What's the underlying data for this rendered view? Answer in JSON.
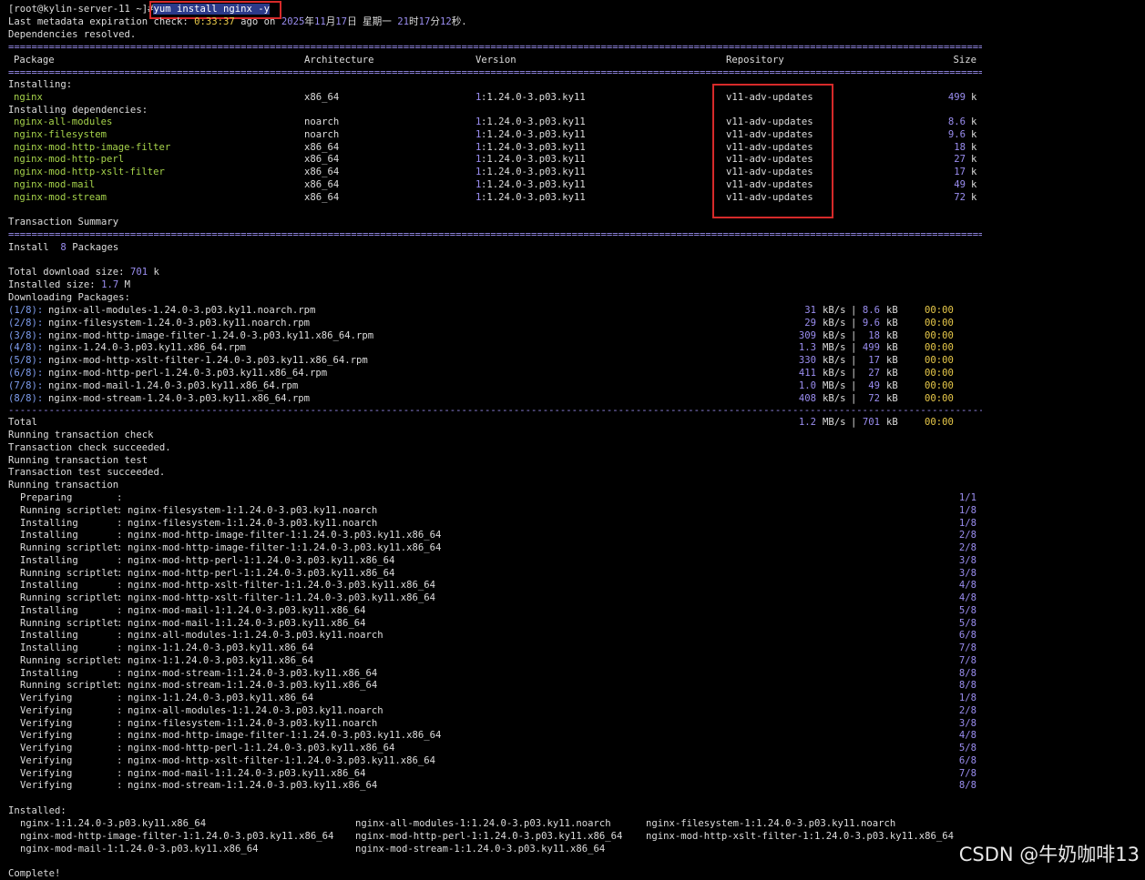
{
  "terminal": {
    "prompt": "[root@kylin-server-11 ~]#",
    "command": "yum install nginx -y",
    "meta_line": {
      "prefix": "Last metadata expiration check:",
      "elapsed": "0:33:37",
      "mid": "ago on",
      "year": "2025",
      "y_unit": "年",
      "month": "11",
      "m_unit": "月",
      "day": "17",
      "d_unit": "日 星期一",
      "hour": "21",
      "h_unit": "时",
      "minute": "17",
      "mi_unit": "分",
      "second": "12",
      "s_unit": "秒."
    },
    "deps_resolved": "Dependencies resolved.",
    "table_headers": {
      "package": "Package",
      "arch": "Architecture",
      "version": "Version",
      "repo": "Repository",
      "size": "Size"
    },
    "installing_label": "Installing:",
    "installing": [
      {
        "name": "nginx",
        "arch": "x86_64",
        "epoch": "1",
        "version": ":1.24.0-3.p03.ky11",
        "repo": "v11-adv-updates",
        "size": "499",
        "unit": "k"
      }
    ],
    "deps_label": "Installing dependencies:",
    "dependencies": [
      {
        "name": "nginx-all-modules",
        "arch": "noarch",
        "epoch": "1",
        "version": ":1.24.0-3.p03.ky11",
        "repo": "v11-adv-updates",
        "size": "8.6",
        "unit": "k"
      },
      {
        "name": "nginx-filesystem",
        "arch": "noarch",
        "epoch": "1",
        "version": ":1.24.0-3.p03.ky11",
        "repo": "v11-adv-updates",
        "size": "9.6",
        "unit": "k"
      },
      {
        "name": "nginx-mod-http-image-filter",
        "arch": "x86_64",
        "epoch": "1",
        "version": ":1.24.0-3.p03.ky11",
        "repo": "v11-adv-updates",
        "size": "18",
        "unit": "k"
      },
      {
        "name": "nginx-mod-http-perl",
        "arch": "x86_64",
        "epoch": "1",
        "version": ":1.24.0-3.p03.ky11",
        "repo": "v11-adv-updates",
        "size": "27",
        "unit": "k"
      },
      {
        "name": "nginx-mod-http-xslt-filter",
        "arch": "x86_64",
        "epoch": "1",
        "version": ":1.24.0-3.p03.ky11",
        "repo": "v11-adv-updates",
        "size": "17",
        "unit": "k"
      },
      {
        "name": "nginx-mod-mail",
        "arch": "x86_64",
        "epoch": "1",
        "version": ":1.24.0-3.p03.ky11",
        "repo": "v11-adv-updates",
        "size": "49",
        "unit": "k"
      },
      {
        "name": "nginx-mod-stream",
        "arch": "x86_64",
        "epoch": "1",
        "version": ":1.24.0-3.p03.ky11",
        "repo": "v11-adv-updates",
        "size": "72",
        "unit": "k"
      }
    ],
    "transaction_summary": "Transaction Summary",
    "install_count": {
      "label": "Install",
      "count": "8",
      "suffix": "Packages"
    },
    "total_download": {
      "label": "Total download size:",
      "value": "701",
      "unit": "k"
    },
    "installed_size": {
      "label": "Installed size:",
      "value": "1.7",
      "unit": "M"
    },
    "downloading_label": "Downloading Packages:",
    "downloads": [
      {
        "idx": "(1/8):",
        "file": "nginx-all-modules-1.24.0-3.p03.ky11.noarch.rpm",
        "speed": "31",
        "speed_unit": "kB/s",
        "size": "8.6",
        "size_unit": "kB",
        "time": "00:00"
      },
      {
        "idx": "(2/8):",
        "file": "nginx-filesystem-1.24.0-3.p03.ky11.noarch.rpm",
        "speed": "29",
        "speed_unit": "kB/s",
        "size": "9.6",
        "size_unit": "kB",
        "time": "00:00"
      },
      {
        "idx": "(3/8):",
        "file": "nginx-mod-http-image-filter-1.24.0-3.p03.ky11.x86_64.rpm",
        "speed": "309",
        "speed_unit": "kB/s",
        "size": "18",
        "size_unit": "kB",
        "time": "00:00"
      },
      {
        "idx": "(4/8):",
        "file": "nginx-1.24.0-3.p03.ky11.x86_64.rpm",
        "speed": "1.3",
        "speed_unit": "MB/s",
        "size": "499",
        "size_unit": "kB",
        "time": "00:00"
      },
      {
        "idx": "(5/8):",
        "file": "nginx-mod-http-xslt-filter-1.24.0-3.p03.ky11.x86_64.rpm",
        "speed": "330",
        "speed_unit": "kB/s",
        "size": "17",
        "size_unit": "kB",
        "time": "00:00"
      },
      {
        "idx": "(6/8):",
        "file": "nginx-mod-http-perl-1.24.0-3.p03.ky11.x86_64.rpm",
        "speed": "411",
        "speed_unit": "kB/s",
        "size": "27",
        "size_unit": "kB",
        "time": "00:00"
      },
      {
        "idx": "(7/8):",
        "file": "nginx-mod-mail-1.24.0-3.p03.ky11.x86_64.rpm",
        "speed": "1.0",
        "speed_unit": "MB/s",
        "size": "49",
        "size_unit": "kB",
        "time": "00:00"
      },
      {
        "idx": "(8/8):",
        "file": "nginx-mod-stream-1.24.0-3.p03.ky11.x86_64.rpm",
        "speed": "408",
        "speed_unit": "kB/s",
        "size": "72",
        "size_unit": "kB",
        "time": "00:00"
      }
    ],
    "total": {
      "label": "Total",
      "speed": "1.2",
      "speed_unit": "MB/s",
      "size": "701",
      "size_unit": "kB",
      "time": "00:00"
    },
    "status_lines": [
      "Running transaction check",
      "Transaction check succeeded.",
      "Running transaction test",
      "Transaction test succeeded.",
      "Running transaction"
    ],
    "steps": [
      {
        "action": "Preparing",
        "pkg": "",
        "n": "1/1"
      },
      {
        "action": "Running scriptlet",
        "pkg": "nginx-filesystem-1:1.24.0-3.p03.ky11.noarch",
        "n": "1/8"
      },
      {
        "action": "Installing",
        "pkg": "nginx-filesystem-1:1.24.0-3.p03.ky11.noarch",
        "n": "1/8"
      },
      {
        "action": "Installing",
        "pkg": "nginx-mod-http-image-filter-1:1.24.0-3.p03.ky11.x86_64",
        "n": "2/8"
      },
      {
        "action": "Running scriptlet",
        "pkg": "nginx-mod-http-image-filter-1:1.24.0-3.p03.ky11.x86_64",
        "n": "2/8"
      },
      {
        "action": "Installing",
        "pkg": "nginx-mod-http-perl-1:1.24.0-3.p03.ky11.x86_64",
        "n": "3/8"
      },
      {
        "action": "Running scriptlet",
        "pkg": "nginx-mod-http-perl-1:1.24.0-3.p03.ky11.x86_64",
        "n": "3/8"
      },
      {
        "action": "Installing",
        "pkg": "nginx-mod-http-xslt-filter-1:1.24.0-3.p03.ky11.x86_64",
        "n": "4/8"
      },
      {
        "action": "Running scriptlet",
        "pkg": "nginx-mod-http-xslt-filter-1:1.24.0-3.p03.ky11.x86_64",
        "n": "4/8"
      },
      {
        "action": "Installing",
        "pkg": "nginx-mod-mail-1:1.24.0-3.p03.ky11.x86_64",
        "n": "5/8"
      },
      {
        "action": "Running scriptlet",
        "pkg": "nginx-mod-mail-1:1.24.0-3.p03.ky11.x86_64",
        "n": "5/8"
      },
      {
        "action": "Installing",
        "pkg": "nginx-all-modules-1:1.24.0-3.p03.ky11.noarch",
        "n": "6/8"
      },
      {
        "action": "Installing",
        "pkg": "nginx-1:1.24.0-3.p03.ky11.x86_64",
        "n": "7/8"
      },
      {
        "action": "Running scriptlet",
        "pkg": "nginx-1:1.24.0-3.p03.ky11.x86_64",
        "n": "7/8"
      },
      {
        "action": "Installing",
        "pkg": "nginx-mod-stream-1:1.24.0-3.p03.ky11.x86_64",
        "n": "8/8"
      },
      {
        "action": "Running scriptlet",
        "pkg": "nginx-mod-stream-1:1.24.0-3.p03.ky11.x86_64",
        "n": "8/8"
      },
      {
        "action": "Verifying",
        "pkg": "nginx-1:1.24.0-3.p03.ky11.x86_64",
        "n": "1/8"
      },
      {
        "action": "Verifying",
        "pkg": "nginx-all-modules-1:1.24.0-3.p03.ky11.noarch",
        "n": "2/8"
      },
      {
        "action": "Verifying",
        "pkg": "nginx-filesystem-1:1.24.0-3.p03.ky11.noarch",
        "n": "3/8"
      },
      {
        "action": "Verifying",
        "pkg": "nginx-mod-http-image-filter-1:1.24.0-3.p03.ky11.x86_64",
        "n": "4/8"
      },
      {
        "action": "Verifying",
        "pkg": "nginx-mod-http-perl-1:1.24.0-3.p03.ky11.x86_64",
        "n": "5/8"
      },
      {
        "action": "Verifying",
        "pkg": "nginx-mod-http-xslt-filter-1:1.24.0-3.p03.ky11.x86_64",
        "n": "6/8"
      },
      {
        "action": "Verifying",
        "pkg": "nginx-mod-mail-1:1.24.0-3.p03.ky11.x86_64",
        "n": "7/8"
      },
      {
        "action": "Verifying",
        "pkg": "nginx-mod-stream-1:1.24.0-3.p03.ky11.x86_64",
        "n": "8/8"
      }
    ],
    "installed_label": "Installed:",
    "installed_rows": [
      [
        "nginx-1:1.24.0-3.p03.ky11.x86_64",
        "nginx-all-modules-1:1.24.0-3.p03.ky11.noarch",
        "nginx-filesystem-1:1.24.0-3.p03.ky11.noarch"
      ],
      [
        "nginx-mod-http-image-filter-1:1.24.0-3.p03.ky11.x86_64",
        "nginx-mod-http-perl-1:1.24.0-3.p03.ky11.x86_64",
        "nginx-mod-http-xslt-filter-1:1.24.0-3.p03.ky11.x86_64"
      ],
      [
        "nginx-mod-mail-1:1.24.0-3.p03.ky11.x86_64",
        "nginx-mod-stream-1:1.24.0-3.p03.ky11.x86_64",
        ""
      ]
    ],
    "complete": "Complete!"
  },
  "watermark": "CSDN @牛奶咖啡13",
  "colors": {
    "background": "#000000",
    "text": "#dddddd",
    "package_green": "#a6d34b",
    "number_purple": "#9a8df0",
    "highlight_red": "#d62a2a"
  }
}
